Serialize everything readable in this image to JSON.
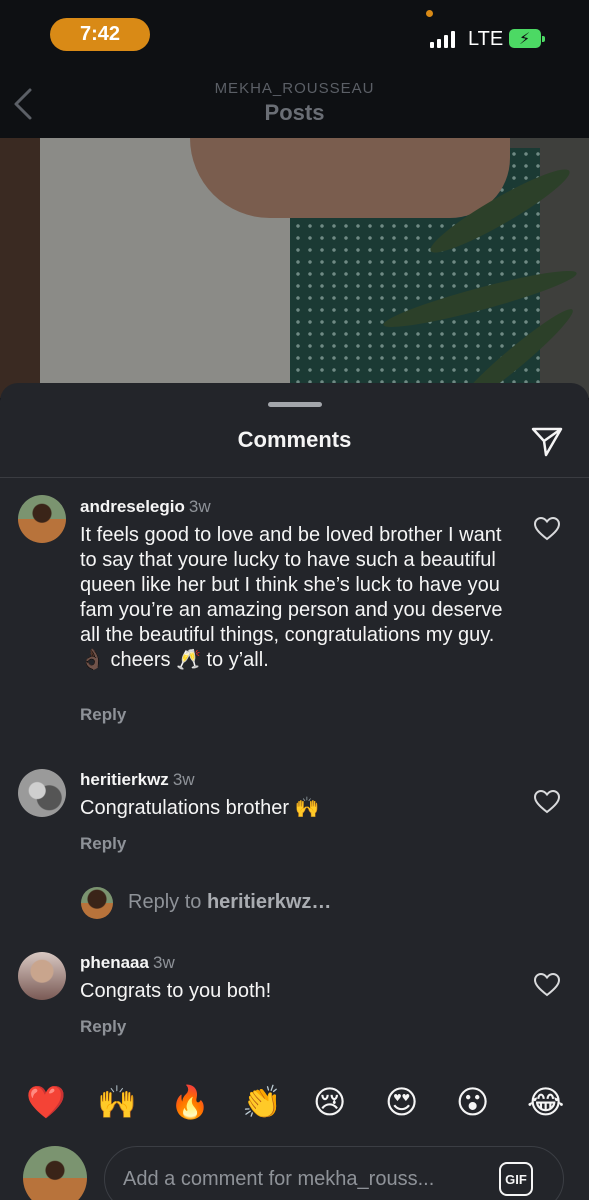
{
  "status_bar": {
    "time": "7:42",
    "network": "LTE"
  },
  "header": {
    "account": "MEKHA_ROUSSEAU",
    "title": "Posts"
  },
  "sheet": {
    "title": "Comments"
  },
  "comments": [
    {
      "username": "andreselegio",
      "time": "3w",
      "text": "It feels good to love and be loved brother I want to say that youre lucky to have such a beautiful queen like her but I think she’s luck to have you fam you’re an amazing person and you deserve all the  beautiful things, congratulations my guy. 👌🏿  cheers 🥂  to y’all.",
      "reply_label": "Reply"
    },
    {
      "username": "heritierkwz",
      "time": "3w",
      "text": "Congratulations brother 🙌",
      "reply_label": "Reply"
    },
    {
      "username": "phenaaa",
      "time": "3w",
      "text": "Congrats to you both!",
      "reply_label": "Reply"
    }
  ],
  "reply_to": {
    "prefix": "Reply to ",
    "username": "heritierkwz…"
  },
  "quick_emojis": [
    "❤️",
    "🙌",
    "🔥",
    "👏",
    "😢",
    "😍",
    "😮",
    "😂"
  ],
  "composer": {
    "placeholder": "Add a comment for mekha_rouss...",
    "gif_label": "GIF"
  }
}
